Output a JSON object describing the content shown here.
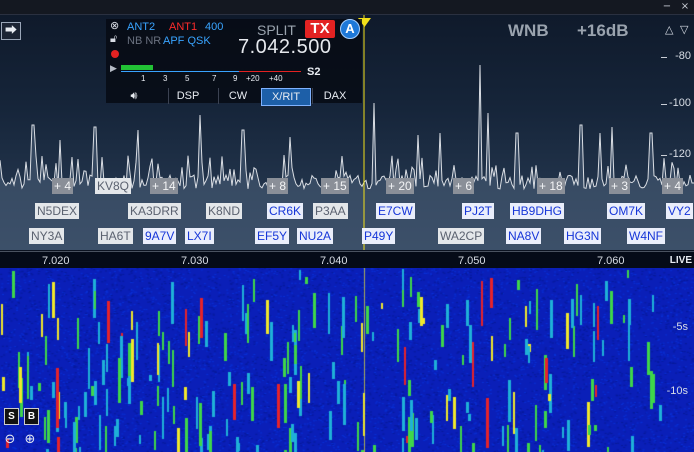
{
  "window": {
    "minimize": "−",
    "close": "×"
  },
  "panadapter": {
    "split_label": "SPLIT",
    "tx_badge": "TX",
    "slice_letter": "A",
    "wnb_label": "WNB",
    "signal_level": "+16dB",
    "dbm_scale": [
      "-80",
      "-100",
      "-120"
    ],
    "zoom_icons": [
      "zoom-out-triangle",
      "zoom-in-triangle"
    ],
    "spectrum_line_color": "#d9dde3",
    "tuned_marker_color": "#f2e01a"
  },
  "slice": {
    "rx_antenna": "ANT2",
    "tx_antenna": "ANT1",
    "filter_width": "400",
    "flags_gray": "NB NR",
    "flags_blue": "APF QSK",
    "frequency": "7.042.500",
    "s_meter_reading": "S2",
    "s_meter_scale": [
      "1",
      "3",
      "5",
      "7",
      "9",
      "+20",
      "+40"
    ],
    "s_meter_level": 0.18,
    "buttons": [
      "DSP",
      "CW",
      "X/RIT",
      "DAX"
    ],
    "active_button": "X/RIT",
    "icons": [
      "close-icon",
      "lock-icon",
      "record-icon",
      "play-icon",
      "speaker-icon"
    ]
  },
  "spot_counts": [
    "+ 4",
    "+ 14",
    "+ 8",
    "+ 15",
    "+ 20",
    "+ 6",
    "+ 18",
    "+ 3",
    "+ 4"
  ],
  "spots_row1": [
    {
      "call": "KV8Q",
      "style": "plain"
    },
    {
      "call": "N5DEX",
      "style": "plain"
    },
    {
      "call": "KA3DRR",
      "style": "plain"
    },
    {
      "call": "K8ND",
      "style": "plain"
    },
    {
      "call": "CR6K",
      "style": "blue"
    },
    {
      "call": "P3AA",
      "style": "plain"
    },
    {
      "call": "E7CW",
      "style": "blue"
    },
    {
      "call": "PJ2T",
      "style": "blue"
    },
    {
      "call": "HB9DHG",
      "style": "blue"
    },
    {
      "call": "OM7K",
      "style": "blue"
    },
    {
      "call": "VY2",
      "style": "blue"
    }
  ],
  "spots_row2": [
    {
      "call": "NY3A",
      "style": "plain"
    },
    {
      "call": "HA6T",
      "style": "plain"
    },
    {
      "call": "9A7V",
      "style": "blue"
    },
    {
      "call": "LX7I",
      "style": "blue"
    },
    {
      "call": "EF5Y",
      "style": "blue"
    },
    {
      "call": "NU2A",
      "style": "blue"
    },
    {
      "call": "P49Y",
      "style": "blue"
    },
    {
      "call": "WA2CP",
      "style": "plain"
    },
    {
      "call": "NA8V",
      "style": "blue"
    },
    {
      "call": "HG3N",
      "style": "blue"
    },
    {
      "call": "W4NF",
      "style": "blue"
    }
  ],
  "frequency_scale": [
    "7.020",
    "7.030",
    "7.040",
    "7.050",
    "7.060"
  ],
  "waterfall": {
    "live_label": "LIVE",
    "time_labels": [
      "-5s",
      "-10s"
    ],
    "buttons": [
      "S",
      "B"
    ],
    "zoom_icons": [
      "zoom-out-icon",
      "zoom-in-icon"
    ]
  }
}
